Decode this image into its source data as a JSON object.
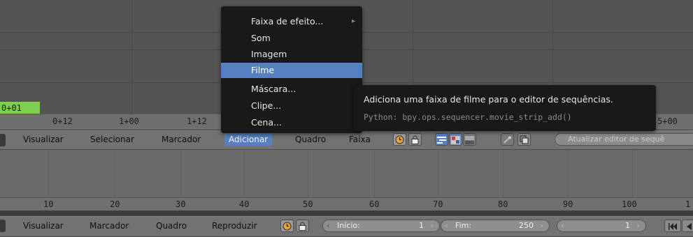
{
  "sequencer": {
    "current_frame_label": "0+01",
    "ruler_ticks": [
      "0+12",
      "1+00",
      "1+12",
      "5+00"
    ]
  },
  "sequencer_header": {
    "menus": [
      "Visualizar",
      "Selecionar",
      "Marcador",
      "Adicionar",
      "Quadro",
      "Faixa"
    ],
    "active_menu": "Adicionar",
    "refresh_button": "Atualizar editor de sequê"
  },
  "add_menu": {
    "items": [
      {
        "label": "Faixa de efeito...",
        "has_submenu": true,
        "highlighted": false
      },
      {
        "label": "Som",
        "has_submenu": false,
        "highlighted": false
      },
      {
        "label": "Imagem",
        "has_submenu": false,
        "highlighted": false
      },
      {
        "label": "Filme",
        "has_submenu": false,
        "highlighted": true
      },
      {
        "label": "Máscara...",
        "has_submenu": false,
        "highlighted": false
      },
      {
        "label": "Clipe...",
        "has_submenu": false,
        "highlighted": false
      },
      {
        "label": "Cena...",
        "has_submenu": false,
        "highlighted": false
      }
    ]
  },
  "tooltip": {
    "title": "Adiciona uma faixa de filme para o editor de sequências.",
    "python": "Python: bpy.ops.sequencer.movie_strip_add()"
  },
  "timeline": {
    "ruler_ticks": [
      "10",
      "20",
      "30",
      "40",
      "50",
      "60",
      "70",
      "80",
      "90",
      "100",
      "1"
    ]
  },
  "timeline_header": {
    "menus": [
      "Visualizar",
      "Marcador",
      "Quadro",
      "Reproduzir"
    ],
    "start_label": "Início:",
    "start_value": "1",
    "end_label": "Fim:",
    "end_value": "250",
    "current_frame": "1"
  },
  "colors": {
    "accent": "#5680c2",
    "current_frame_marker": "#7ecf4e"
  }
}
